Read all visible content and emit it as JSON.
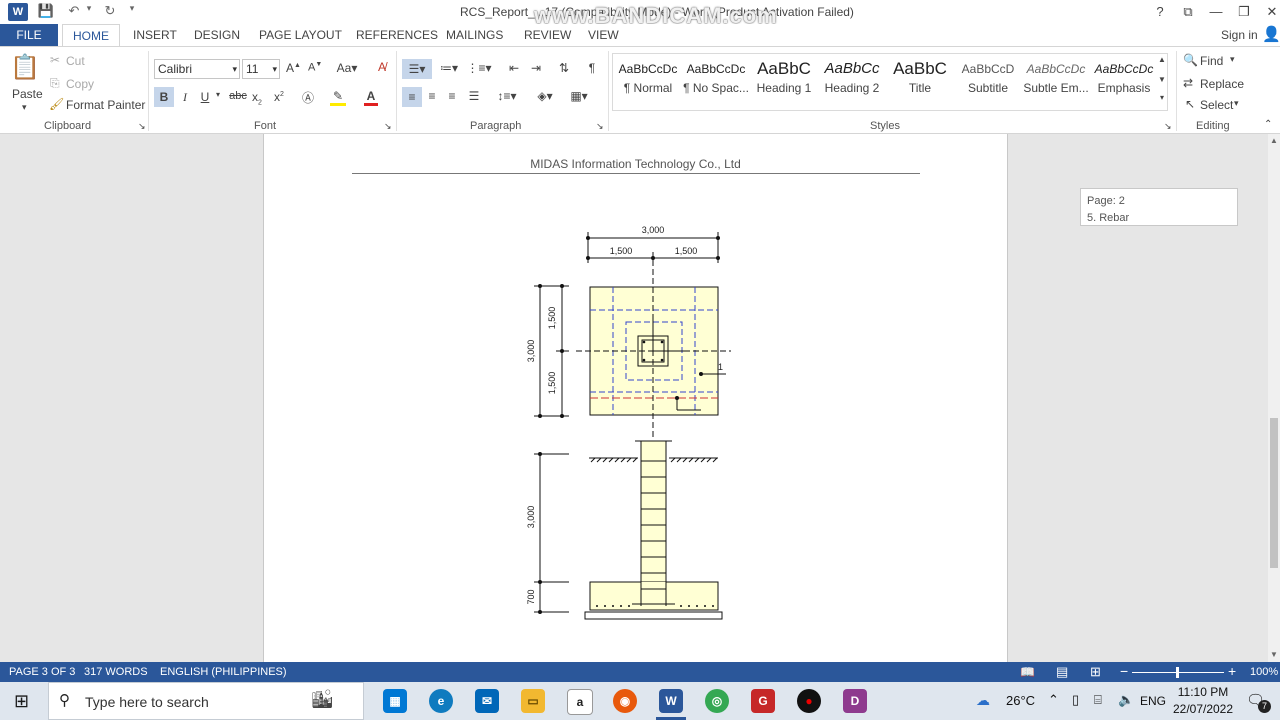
{
  "window": {
    "title": "RCS_Report_...17 (Compatibility Mode) - Word (Product Activation Failed)",
    "watermark": "www.BANDICAM.com",
    "help": "?"
  },
  "tabs": [
    "FILE",
    "HOME",
    "INSERT",
    "DESIGN",
    "PAGE LAYOUT",
    "REFERENCES",
    "MAILINGS",
    "REVIEW",
    "VIEW"
  ],
  "sign_in": "Sign in",
  "clipboard": {
    "paste": "Paste",
    "cut": "Cut",
    "copy": "Copy",
    "format_painter": "Format Painter",
    "label": "Clipboard"
  },
  "font": {
    "name": "Calibri",
    "size": "11",
    "label": "Font",
    "case": "Aa"
  },
  "paragraph": {
    "label": "Paragraph"
  },
  "styles": {
    "label": "Styles",
    "items": [
      {
        "preview": "AaBbCcDc",
        "name": "¶ Normal"
      },
      {
        "preview": "AaBbCcDc",
        "name": "¶ No Spac..."
      },
      {
        "preview": "AaBbC",
        "name": "Heading 1"
      },
      {
        "preview": "AaBbCc",
        "name": "Heading 2"
      },
      {
        "preview": "AaBbC",
        "name": "Title"
      },
      {
        "preview": "AaBbCcD",
        "name": "Subtitle"
      },
      {
        "preview": "AaBbCcDc",
        "name": "Subtle Em..."
      },
      {
        "preview": "AaBbCcDc",
        "name": "Emphasis"
      }
    ]
  },
  "editing": {
    "find": "Find",
    "replace": "Replace",
    "select": "Select",
    "label": "Editing"
  },
  "document": {
    "header": "MIDAS Information Technology Co., Ltd",
    "nav_page": "Page: 2",
    "nav_section": "5. Rebar",
    "drawing": {
      "top_total": "3,000",
      "top_left": "1,500",
      "top_right": "1,500",
      "left_total": "3,000",
      "left_top": "1,500",
      "left_bottom": "1,500",
      "col_height": "3,000",
      "footing_height": "700",
      "axis_y": "Y1",
      "axis_x": "X1"
    }
  },
  "status": {
    "page": "PAGE 3 OF 3",
    "words": "317 WORDS",
    "language": "ENGLISH (PHILIPPINES)",
    "zoom": "100%"
  },
  "taskbar": {
    "search_placeholder": "Type here to search",
    "weather": "26°C",
    "lang": "ENG",
    "time": "11:10 PM",
    "date": "22/07/2022",
    "notif_count": "7"
  }
}
